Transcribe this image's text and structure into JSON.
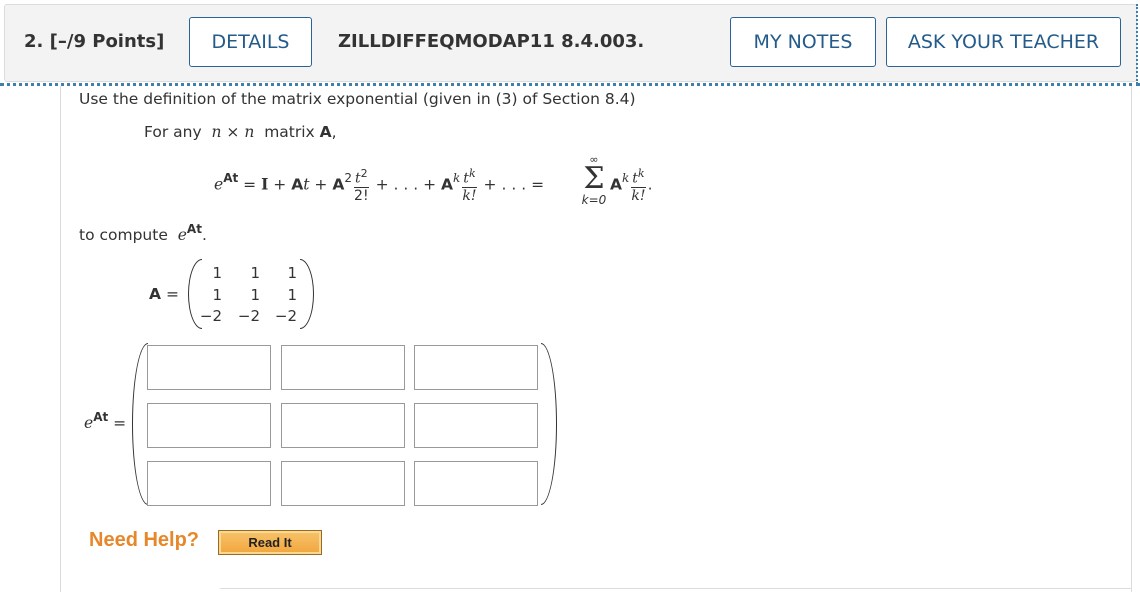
{
  "header": {
    "question_number": "2.",
    "points": "[–/9 Points]",
    "details_label": "DETAILS",
    "code": "ZILLDIFFEQMODAP11 8.4.003.",
    "my_notes_label": "MY NOTES",
    "ask_teacher_label": "ASK YOUR TEACHER"
  },
  "problem": {
    "intro": "Use the definition of the matrix exponential (given in (3) of Section 8.4)",
    "for_any_prefix": "For any",
    "n1": "n",
    "times": "×",
    "n2": "n",
    "matrix_word": "matrix",
    "matrix_A": "A",
    "comma": ",",
    "to_compute": "to compute",
    "eq": {
      "e": "e",
      "At_sup": "At",
      "equals": "=",
      "I": "I",
      "plus1": "+",
      "A1": "A",
      "t1": "t",
      "plus2": "+",
      "A2": "A",
      "A2_sup": "2",
      "frac1_num": "t",
      "frac1_num_sup": "2",
      "frac1_den": "2!",
      "plus3": "+",
      "dots1": ". . .",
      "plus4": "+",
      "Ak": "A",
      "Ak_sup": "k",
      "frac2_num": "t",
      "frac2_num_sup": "k",
      "frac2_den": "k!",
      "plus5": "+",
      "dots2": ". . .",
      "equals2": "=",
      "sigma_top": "∞",
      "sigma": "Σ",
      "sigma_bottom": "k=0",
      "A3": "A",
      "A3_sup": "k",
      "frac3_num": "t",
      "frac3_num_sup": "k",
      "frac3_den": "k!",
      "period": "."
    },
    "compute_e": "e",
    "compute_sup": "At",
    "compute_period": ".",
    "matrix_label": "A",
    "matrix_equals": "=",
    "matrix": [
      [
        "1",
        "1",
        "1"
      ],
      [
        "1",
        "1",
        "1"
      ],
      [
        "−2",
        "−2",
        "−2"
      ]
    ],
    "answer_label_e": "e",
    "answer_label_sup": "At",
    "answer_equals": "=",
    "answer_cells": [
      [
        "",
        "",
        ""
      ],
      [
        "",
        "",
        ""
      ],
      [
        "",
        "",
        ""
      ]
    ]
  },
  "help": {
    "need_help": "Need Help?",
    "read_it": "Read It"
  },
  "colors": {
    "accent": "#2a6496",
    "need_help": "#e8872a",
    "read_it_bg": "#f2a53c"
  }
}
